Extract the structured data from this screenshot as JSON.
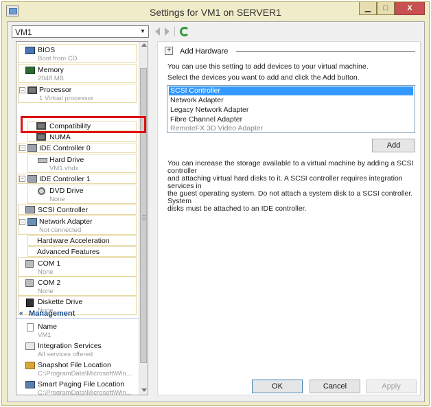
{
  "window": {
    "title": "Settings for VM1 on SERVER1",
    "minimize": "▁",
    "maximize": "□",
    "close": "X"
  },
  "toolbar": {
    "vm_selector": "VM1"
  },
  "tree": {
    "bios": {
      "label": "BIOS",
      "sub": "Boot from CD"
    },
    "memory": {
      "label": "Memory",
      "sub": "2048 MB"
    },
    "processor": {
      "label": "Processor",
      "sub": "1 Virtual processor"
    },
    "compatibility": {
      "label": "Compatibility"
    },
    "numa": {
      "label": "NUMA"
    },
    "ide0": {
      "label": "IDE Controller 0"
    },
    "hard_drive": {
      "label": "Hard Drive",
      "sub": "VM1.vhdx"
    },
    "ide1": {
      "label": "IDE Controller 1"
    },
    "dvd_drive": {
      "label": "DVD Drive",
      "sub": "None"
    },
    "scsi": {
      "label": "SCSI Controller"
    },
    "network_adapter": {
      "label": "Network Adapter",
      "sub": "Not connected"
    },
    "hw_accel": {
      "label": "Hardware Acceleration"
    },
    "adv_features": {
      "label": "Advanced Features"
    },
    "com1": {
      "label": "COM 1",
      "sub": "None"
    },
    "com2": {
      "label": "COM 2",
      "sub": "None"
    },
    "diskette": {
      "label": "Diskette Drive",
      "sub": "None"
    },
    "management": {
      "label": "Management"
    },
    "name": {
      "label": "Name",
      "sub": "VM1"
    },
    "integration": {
      "label": "Integration Services",
      "sub": "All services offered"
    },
    "snapshot": {
      "label": "Snapshot File Location",
      "sub": "C:\\ProgramData\\Microsoft\\Win..."
    },
    "smart_paging": {
      "label": "Smart Paging File Location",
      "sub": "C:\\ProgramData\\Microsoft\\Win..."
    }
  },
  "right": {
    "section_title": "Add Hardware",
    "intro": "You can use this setting to add devices to your virtual machine.",
    "instruction": "Select the devices you want to add and click the Add button.",
    "devices": [
      {
        "label": "SCSI Controller",
        "selected": true
      },
      {
        "label": "Network Adapter"
      },
      {
        "label": "Legacy Network Adapter"
      },
      {
        "label": "Fibre Channel Adapter"
      },
      {
        "label": "RemoteFX 3D Video Adapter",
        "disabled": true
      }
    ],
    "add_button": "Add",
    "description_lines": [
      "You can increase the storage available to a virtual machine by adding a SCSI controller",
      "and attaching virtual hard disks to it. A SCSI controller requires integration services in",
      "the guest operating system. Do not attach a system disk to a SCSI controller. System",
      "disks must be attached to an IDE controller."
    ]
  },
  "footer": {
    "ok": "OK",
    "cancel": "Cancel",
    "apply": "Apply"
  }
}
